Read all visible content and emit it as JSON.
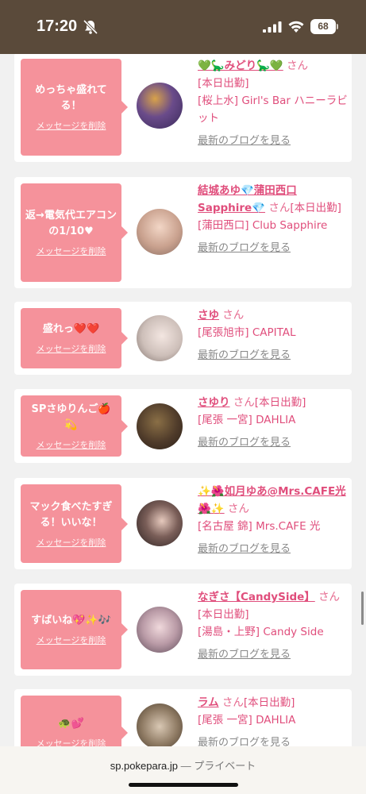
{
  "status_bar": {
    "time": "17:20",
    "battery": "68"
  },
  "cards": [
    {
      "message": "めっちゃ盛れてる！",
      "delete_label": "メッセージを削除",
      "name": "💚🦕みどり🦕💚",
      "san": "さん",
      "lines": [
        "[本日出勤]",
        "[桜上水] Girl's Bar ハニーラビット"
      ],
      "blog_label": "最新のブログを見る"
    },
    {
      "message": "返→電気代エアコンの1/10♥",
      "delete_label": "メッセージを削除",
      "name": "結城あゆ💎蒲田西口Sapphire💎",
      "san": "さん",
      "lines": [
        "[本日出勤]",
        "[蒲田西口] Club Sapphire"
      ],
      "blog_label": "最新のブログを見る"
    },
    {
      "message": "盛れっ❤️❤️",
      "delete_label": "メッセージを削除",
      "name": "さゆ",
      "san": "さん",
      "lines": [
        "[尾張旭市] CAPITAL"
      ],
      "blog_label": "最新のブログを見る"
    },
    {
      "message": "SPさゆりんご🍎💫",
      "delete_label": "メッセージを削除",
      "name": "さゆり",
      "san": "さん",
      "lines": [
        "[本日出勤]",
        "[尾張 一宮] DAHLIA"
      ],
      "blog_label": "最新のブログを見る"
    },
    {
      "message": "マック食べたすぎる！いいな！",
      "delete_label": "メッセージを削除",
      "name": "✨🌺如月ゆあ@Mrs.CAFE光🌺✨",
      "san": "さん",
      "lines": [
        "[名古屋 錦] Mrs.CAFE 光"
      ],
      "blog_label": "最新のブログを見る"
    },
    {
      "message": "すばいね💖✨🎶",
      "delete_label": "メッセージを削除",
      "name": "なぎさ【CandySide】",
      "san": "さん",
      "lines": [
        "[本日出勤]",
        "[湯島・上野] Candy Side"
      ],
      "blog_label": "最新のブログを見る"
    },
    {
      "message": "🐢💕",
      "delete_label": "メッセージを削除",
      "name": "ラム",
      "san": "さん",
      "lines": [
        "[本日出勤]",
        "[尾張 一宮] DAHLIA"
      ],
      "blog_label": "最新のブログを見る"
    }
  ],
  "url_bar": {
    "domain": "sp.pokepara.jp",
    "separator": "—",
    "mode": "プライベート"
  }
}
